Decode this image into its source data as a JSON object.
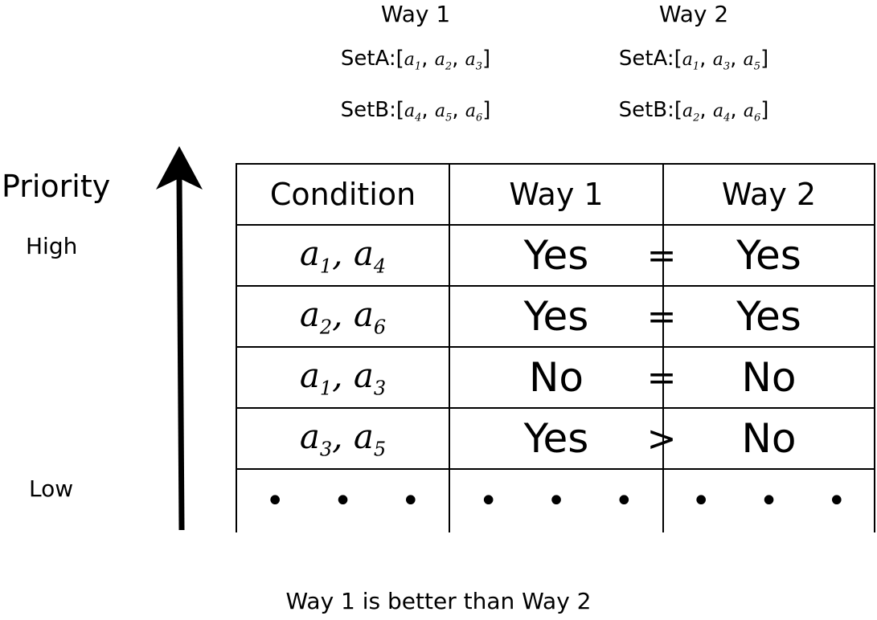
{
  "header": {
    "way1": {
      "title": "Way 1",
      "setA_label": "SetA:[",
      "setA": [
        {
          "base": "a",
          "sub": "1"
        },
        {
          "base": "a",
          "sub": "2"
        },
        {
          "base": "a",
          "sub": "3"
        }
      ],
      "setB_label": "SetB:[",
      "setB": [
        {
          "base": "a",
          "sub": "4"
        },
        {
          "base": "a",
          "sub": "5"
        },
        {
          "base": "a",
          "sub": "6"
        }
      ]
    },
    "way2": {
      "title": "Way 2",
      "setA_label": "SetA:[",
      "setA": [
        {
          "base": "a",
          "sub": "1"
        },
        {
          "base": "a",
          "sub": "3"
        },
        {
          "base": "a",
          "sub": "5"
        }
      ],
      "setB_label": "SetB:[",
      "setB": [
        {
          "base": "a",
          "sub": "2"
        },
        {
          "base": "a",
          "sub": "4"
        },
        {
          "base": "a",
          "sub": "6"
        }
      ]
    }
  },
  "labels": {
    "priority": "Priority",
    "high": "High",
    "low": "Low",
    "caption": "Way 1 is better than Way 2"
  },
  "table": {
    "headers": [
      "Condition",
      "Way 1",
      "Way 2"
    ],
    "rows": [
      {
        "cond": [
          {
            "base": "a",
            "sub": "1"
          },
          {
            "base": "a",
            "sub": "4"
          }
        ],
        "way1": "Yes",
        "cmp": "=",
        "way2": "Yes"
      },
      {
        "cond": [
          {
            "base": "a",
            "sub": "2"
          },
          {
            "base": "a",
            "sub": "6"
          }
        ],
        "way1": "Yes",
        "cmp": "=",
        "way2": "Yes"
      },
      {
        "cond": [
          {
            "base": "a",
            "sub": "1"
          },
          {
            "base": "a",
            "sub": "3"
          }
        ],
        "way1": "No",
        "cmp": "=",
        "way2": "No"
      },
      {
        "cond": [
          {
            "base": "a",
            "sub": "3"
          },
          {
            "base": "a",
            "sub": "5"
          }
        ],
        "way1": "Yes",
        "cmp": ">",
        "way2": "No"
      }
    ],
    "ellipsis": "• • •"
  }
}
